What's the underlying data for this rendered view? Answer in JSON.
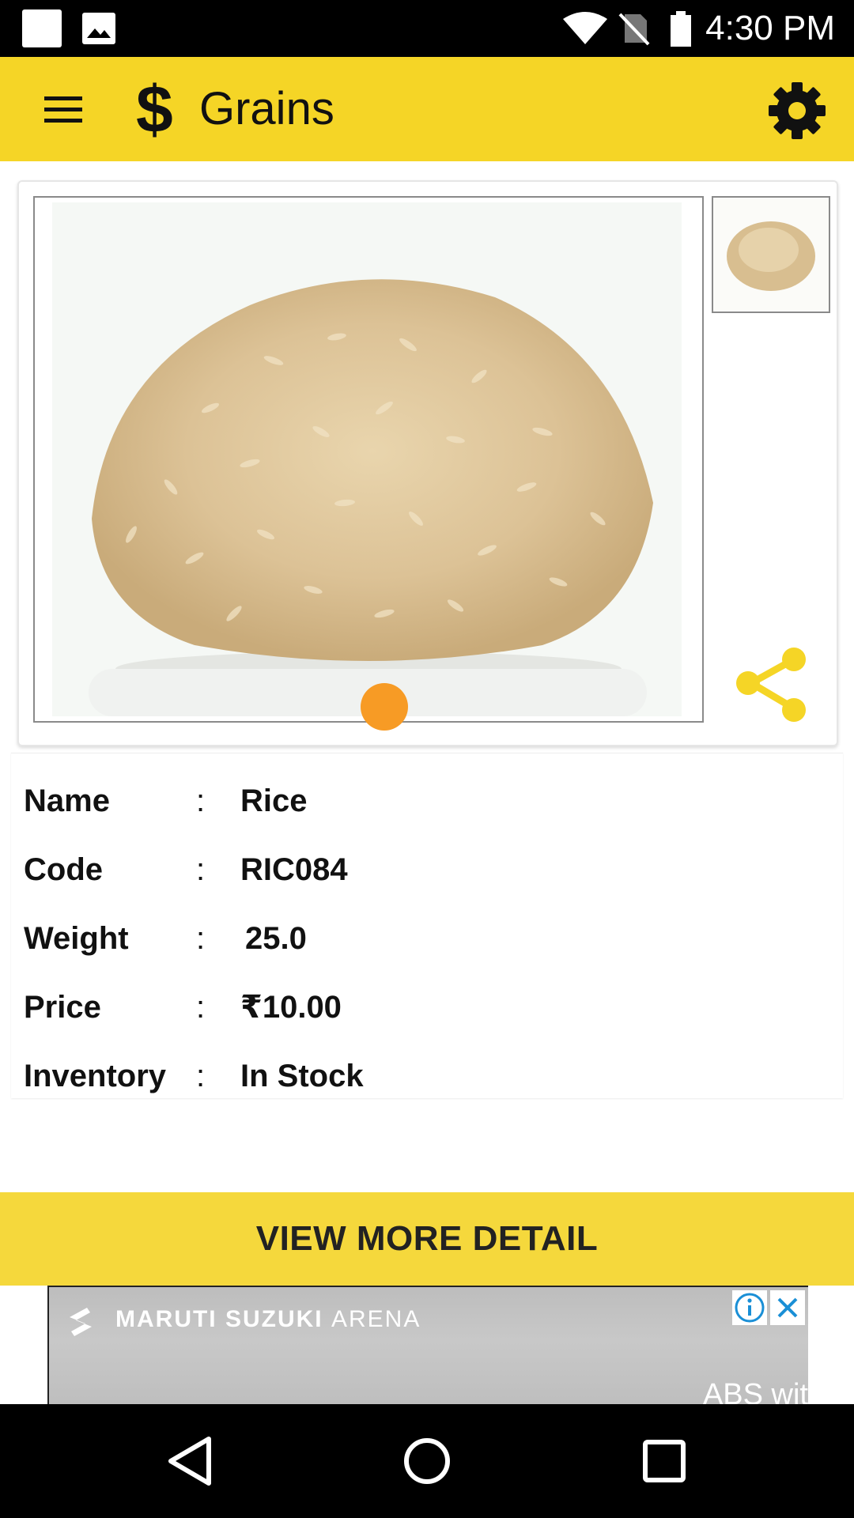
{
  "status_bar": {
    "time": "4:30 PM"
  },
  "app_bar": {
    "title": "Grains"
  },
  "product": {
    "name_label": "Name",
    "name_value": "Rice",
    "code_label": "Code",
    "code_value": "RIC084",
    "weight_label": "Weight",
    "weight_value": "25.0",
    "price_label": "Price",
    "price_value": "₹10.00",
    "inventory_label": "Inventory",
    "inventory_value": "In Stock",
    "separator": ":"
  },
  "cta": {
    "label": "VIEW MORE DETAIL"
  },
  "ad": {
    "brand_primary": "MARUTI SUZUKI",
    "brand_secondary": "ARENA",
    "tagline": "ABS wit"
  },
  "colors": {
    "accent": "#f5d526",
    "pager_dot": "#f79b25",
    "share": "#f5d526"
  }
}
